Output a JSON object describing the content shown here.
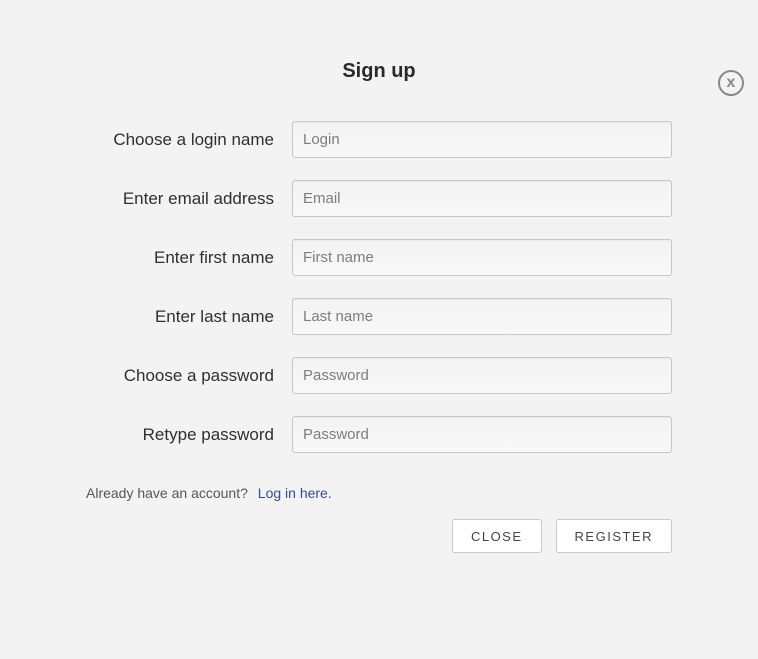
{
  "title": "Sign up",
  "fields": {
    "login": {
      "label": "Choose a login name",
      "placeholder": "Login",
      "value": ""
    },
    "email": {
      "label": "Enter email address",
      "placeholder": "Email",
      "value": ""
    },
    "first": {
      "label": "Enter first name",
      "placeholder": "First name",
      "value": ""
    },
    "last": {
      "label": "Enter last name",
      "placeholder": "Last name",
      "value": ""
    },
    "password": {
      "label": "Choose a password",
      "placeholder": "Password",
      "value": ""
    },
    "retype": {
      "label": "Retype password",
      "placeholder": "Password",
      "value": ""
    }
  },
  "already": {
    "text": "Already have an account?",
    "link": "Log in here."
  },
  "buttons": {
    "close": "CLOSE",
    "register": "REGISTER"
  },
  "close_x": "x"
}
